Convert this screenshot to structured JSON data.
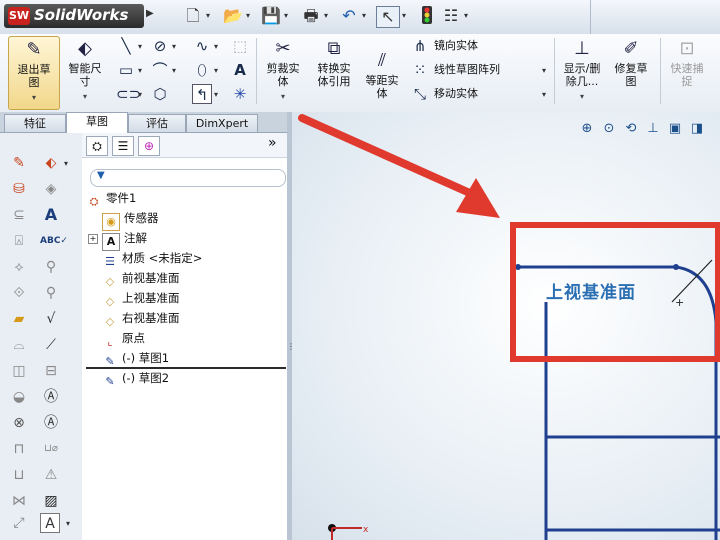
{
  "app": {
    "logo_text": "SW",
    "name": "SolidWorks"
  },
  "quickbar": {
    "icons": [
      "new-document-icon",
      "open-folder-icon",
      "save-icon",
      "print-icon",
      "undo-icon",
      "select-pointer-icon",
      "traffic-light-icon",
      "options-list-icon"
    ]
  },
  "ribbon": {
    "exit_sketch": "退出草\n图",
    "smart_dimension": "智能尺\n寸",
    "trim": "剪裁实\n体",
    "convert": "转换实\n体引用",
    "offset": "等距实\n体",
    "mirror": "镜向实体",
    "linear_pattern": "线性草图阵列",
    "move": "移动实体",
    "display_delete": "显示/删\n除几...",
    "repair": "修复草\n图",
    "quick_snap": "快速捕\n捉"
  },
  "tabs": [
    {
      "label": "特征",
      "active": false
    },
    {
      "label": "草图",
      "active": true
    },
    {
      "label": "评估",
      "active": false
    },
    {
      "label": "DimXpert",
      "active": false
    }
  ],
  "tree": {
    "collapse_glyph": "»",
    "nodes": [
      {
        "label": "零件1",
        "icon": "part-icon"
      },
      {
        "label": "传感器",
        "icon": "sensor-icon"
      },
      {
        "label": "注解",
        "icon": "annotation-icon",
        "expander": "+"
      },
      {
        "label": "材质 <未指定>",
        "icon": "material-icon"
      },
      {
        "label": "前视基准面",
        "icon": "plane-icon"
      },
      {
        "label": "上视基准面",
        "icon": "plane-icon"
      },
      {
        "label": "右视基准面",
        "icon": "plane-icon"
      },
      {
        "label": "原点",
        "icon": "origin-icon"
      },
      {
        "label": "(-) 草图1",
        "icon": "sketch-icon"
      },
      {
        "label": "(-) 草图2",
        "icon": "sketch-icon"
      }
    ]
  },
  "graphics": {
    "plane_label": "上视基准面",
    "highlight_color": "#e03a2f",
    "sketch_color": "#1f3f8f",
    "origin_x_label": "x"
  }
}
